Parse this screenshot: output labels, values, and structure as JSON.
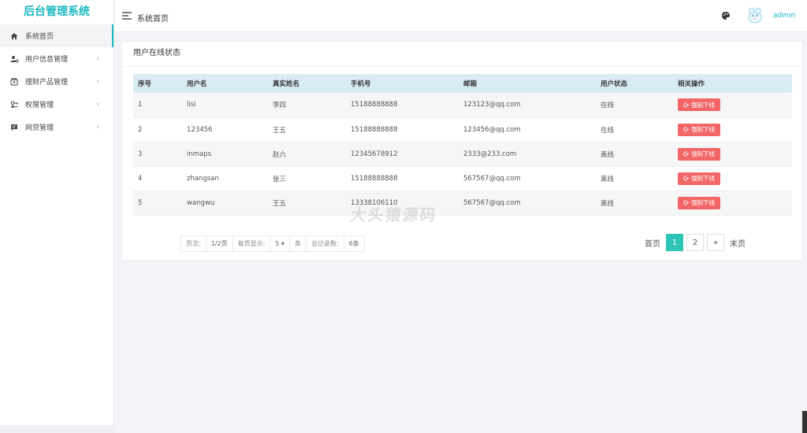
{
  "app": {
    "title": "后台管理系统"
  },
  "sidebar": {
    "items": [
      {
        "label": "系统首页",
        "icon": "home-icon",
        "active": true,
        "arrow": ""
      },
      {
        "label": "用户信息管理",
        "icon": "user-gear-icon",
        "active": false,
        "arrow": "›"
      },
      {
        "label": "理财产品管理",
        "icon": "wallet-icon",
        "active": false,
        "arrow": "›"
      },
      {
        "label": "权限管理",
        "icon": "key-icon",
        "active": false,
        "arrow": "›"
      },
      {
        "label": "网贷管理",
        "icon": "message-icon",
        "active": false,
        "arrow": "›"
      }
    ]
  },
  "header": {
    "page_title": "系统首页",
    "username": "admin"
  },
  "card": {
    "title": "用户在线状态"
  },
  "table": {
    "columns": [
      "序号",
      "用户名",
      "真实姓名",
      "手机号",
      "邮箱",
      "用户状态",
      "相关操作"
    ],
    "rows": [
      {
        "id": "1",
        "username": "lisi",
        "realname": "李四",
        "phone": "15188888888",
        "email": "123123@qq.com",
        "status": "在线",
        "action": "强制下线"
      },
      {
        "id": "2",
        "username": "123456",
        "realname": "王五",
        "phone": "15188888888",
        "email": "123456@qq.com",
        "status": "在线",
        "action": "强制下线"
      },
      {
        "id": "3",
        "username": "inmaps",
        "realname": "赵六",
        "phone": "12345678912",
        "email": "2333@233.com",
        "status": "离线",
        "action": "强制下线"
      },
      {
        "id": "4",
        "username": "zhangsan",
        "realname": "张三",
        "phone": "15188888888",
        "email": "567567@qq.com",
        "status": "离线",
        "action": "强制下线"
      },
      {
        "id": "5",
        "username": "wangwu",
        "realname": "王五",
        "phone": "13338106110",
        "email": "567567@qq.com",
        "status": "离线",
        "action": "强制下线"
      }
    ]
  },
  "pager_info": {
    "page_label": "页次:",
    "page_value": "1/2页",
    "per_page_label": "每页显示:",
    "per_page_value": "5 ▾",
    "per_page_unit": "条",
    "total_label": "总记录数:",
    "total_value": "6条"
  },
  "pagination": {
    "first": "首页",
    "pages": [
      "1",
      "2"
    ],
    "next": "»",
    "last": "末页"
  },
  "watermark": "大头猿源码",
  "colors": {
    "accent": "#1bb8c2",
    "danger": "#f26668",
    "active_page": "#2ec4b6",
    "table_header": "#d8ecf4"
  }
}
